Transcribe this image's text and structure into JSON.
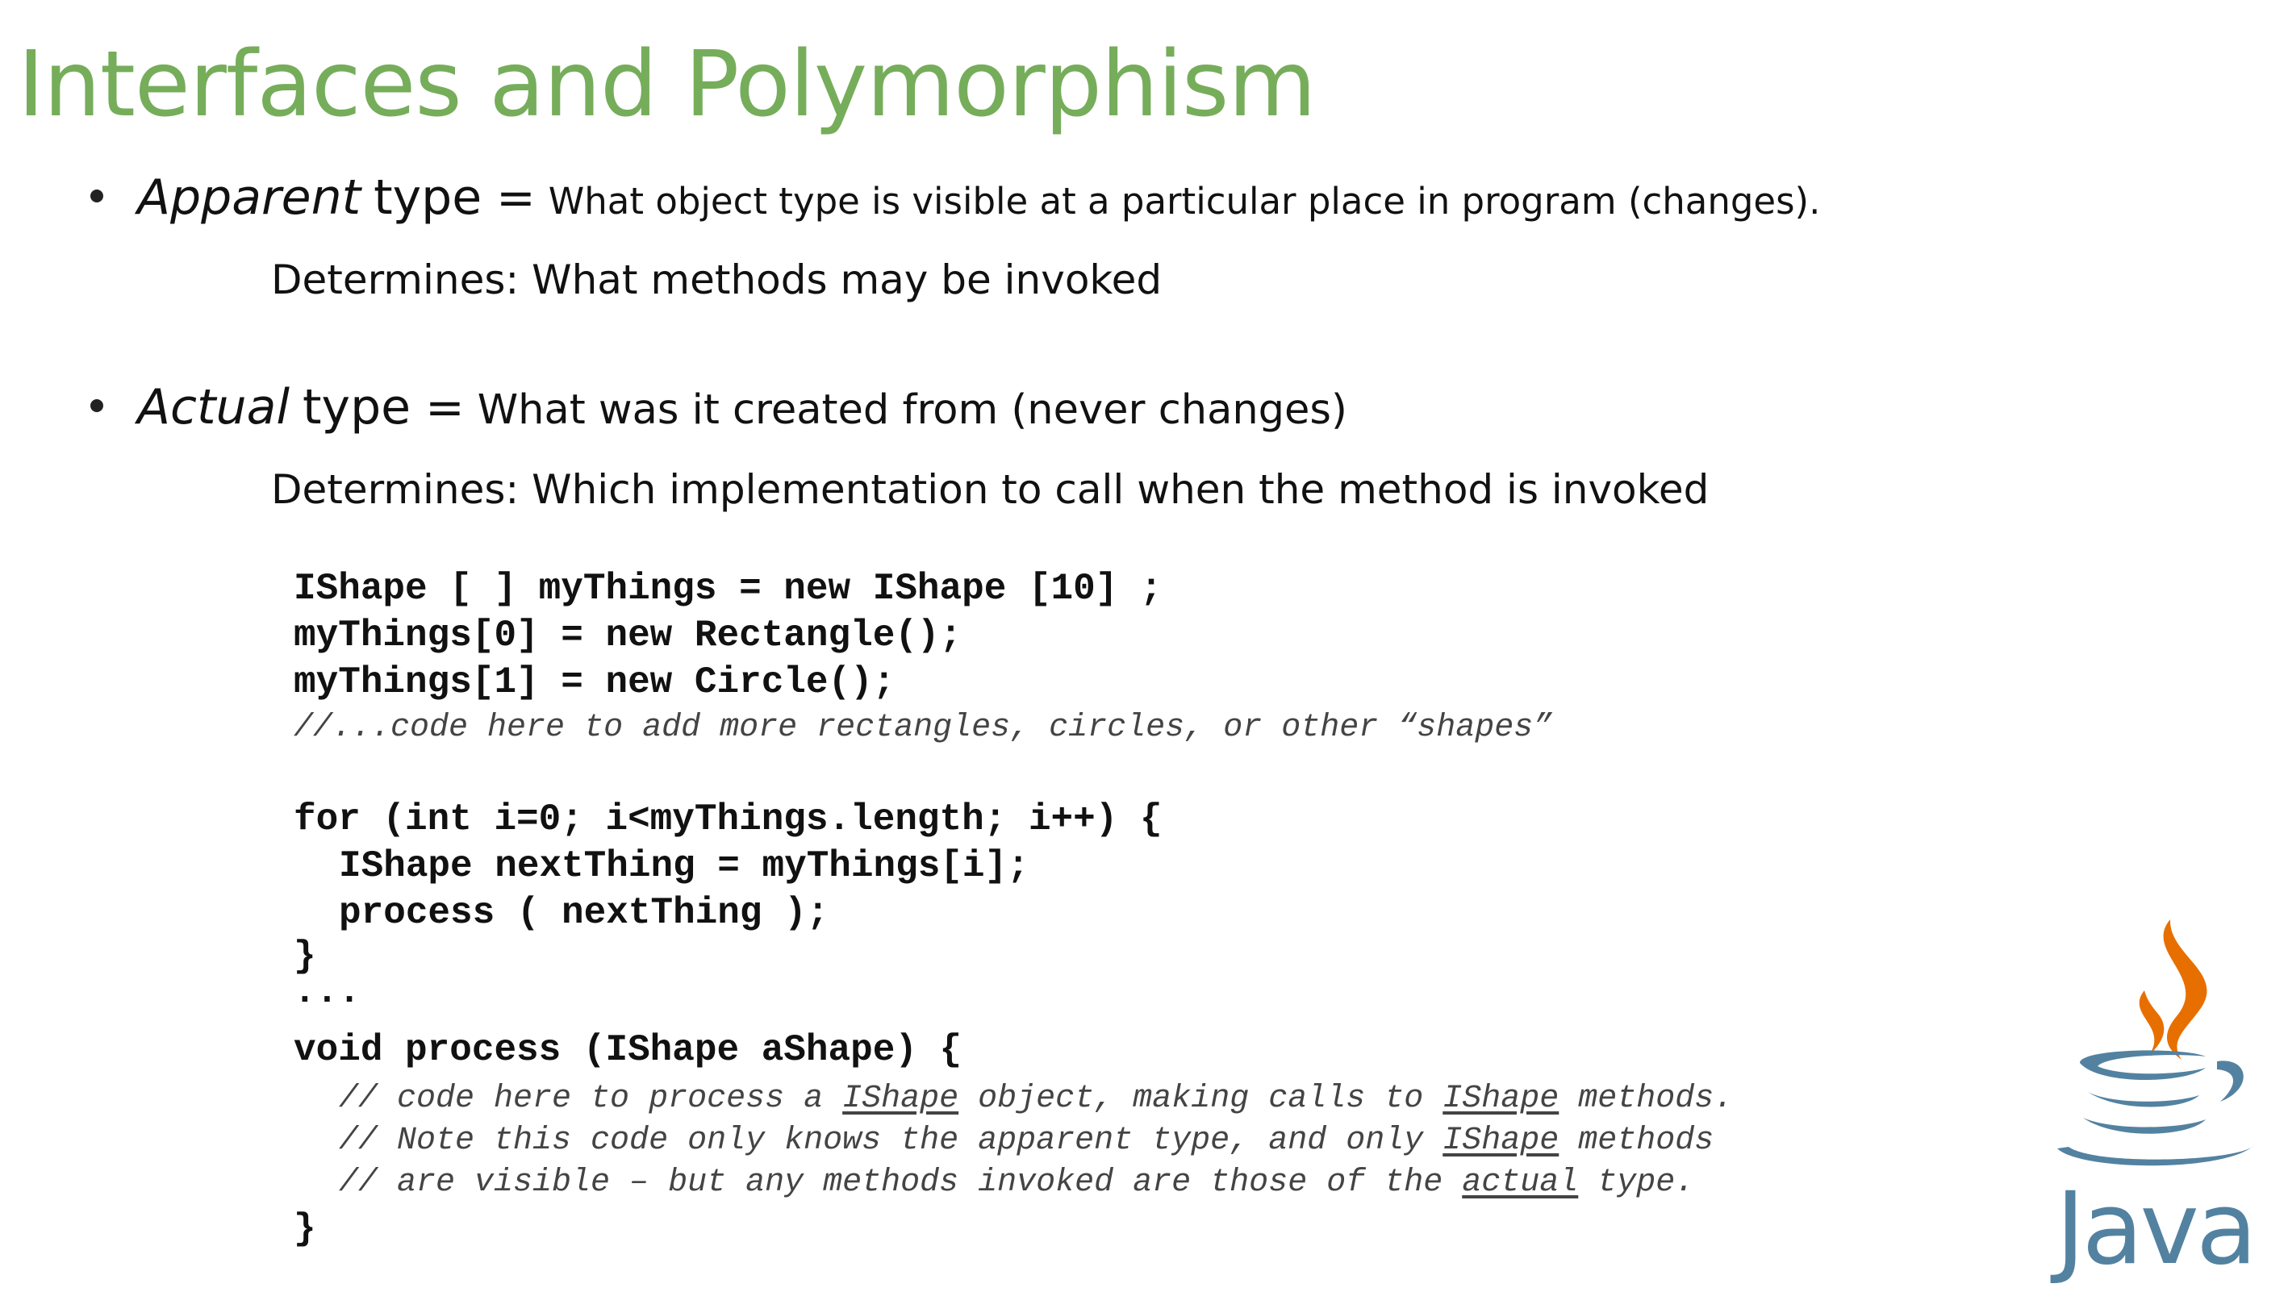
{
  "slide": {
    "title": "Interfaces and Polymorphism",
    "bullets": [
      {
        "term": "Apparent",
        "type_word": "type",
        "equals": "=",
        "definition": "What object type is visible at a  particular place in program (changes).",
        "determines": "Determines: What methods may be invoked"
      },
      {
        "term": "Actual",
        "type_word": "type",
        "equals": "=",
        "definition": "What was it created from (never changes)",
        "determines": "Determines: Which implementation to call when the method is invoked"
      }
    ],
    "code": {
      "l1": "IShape [ ] myThings = new IShape [10] ;",
      "l2": "myThings[0] = new Rectangle();",
      "l3": "myThings[1] = new Circle();",
      "l4": "//...code here to add more rectangles, circles, or other “shapes”",
      "l5": "for (int i=0; i<myThings.length; i++) {",
      "l6": "IShape nextThing = myThings[i];",
      "l7": "process ( nextThing );",
      "l8": "}",
      "l9": "...",
      "l10": "void process (IShape aShape) {",
      "l11": {
        "a": "// code here to process a ",
        "b": "IShape",
        "c": " object, making calls to ",
        "d": "IShape",
        "e": " methods."
      },
      "l12": {
        "a": "// Note this code only knows the apparent type, and only ",
        "b": "IShape",
        "c": " methods"
      },
      "l13": {
        "a": "// are visible – but any methods invoked are those of the ",
        "b": "actual",
        "c": " type."
      },
      "l14": "}"
    },
    "logo": {
      "word": "Java",
      "icon": "java-coffee-cup-icon",
      "steam_color": "#e76f00",
      "cup_color": "#5382a1"
    },
    "colors": {
      "title": "#76ad5a",
      "text": "#111111"
    }
  }
}
